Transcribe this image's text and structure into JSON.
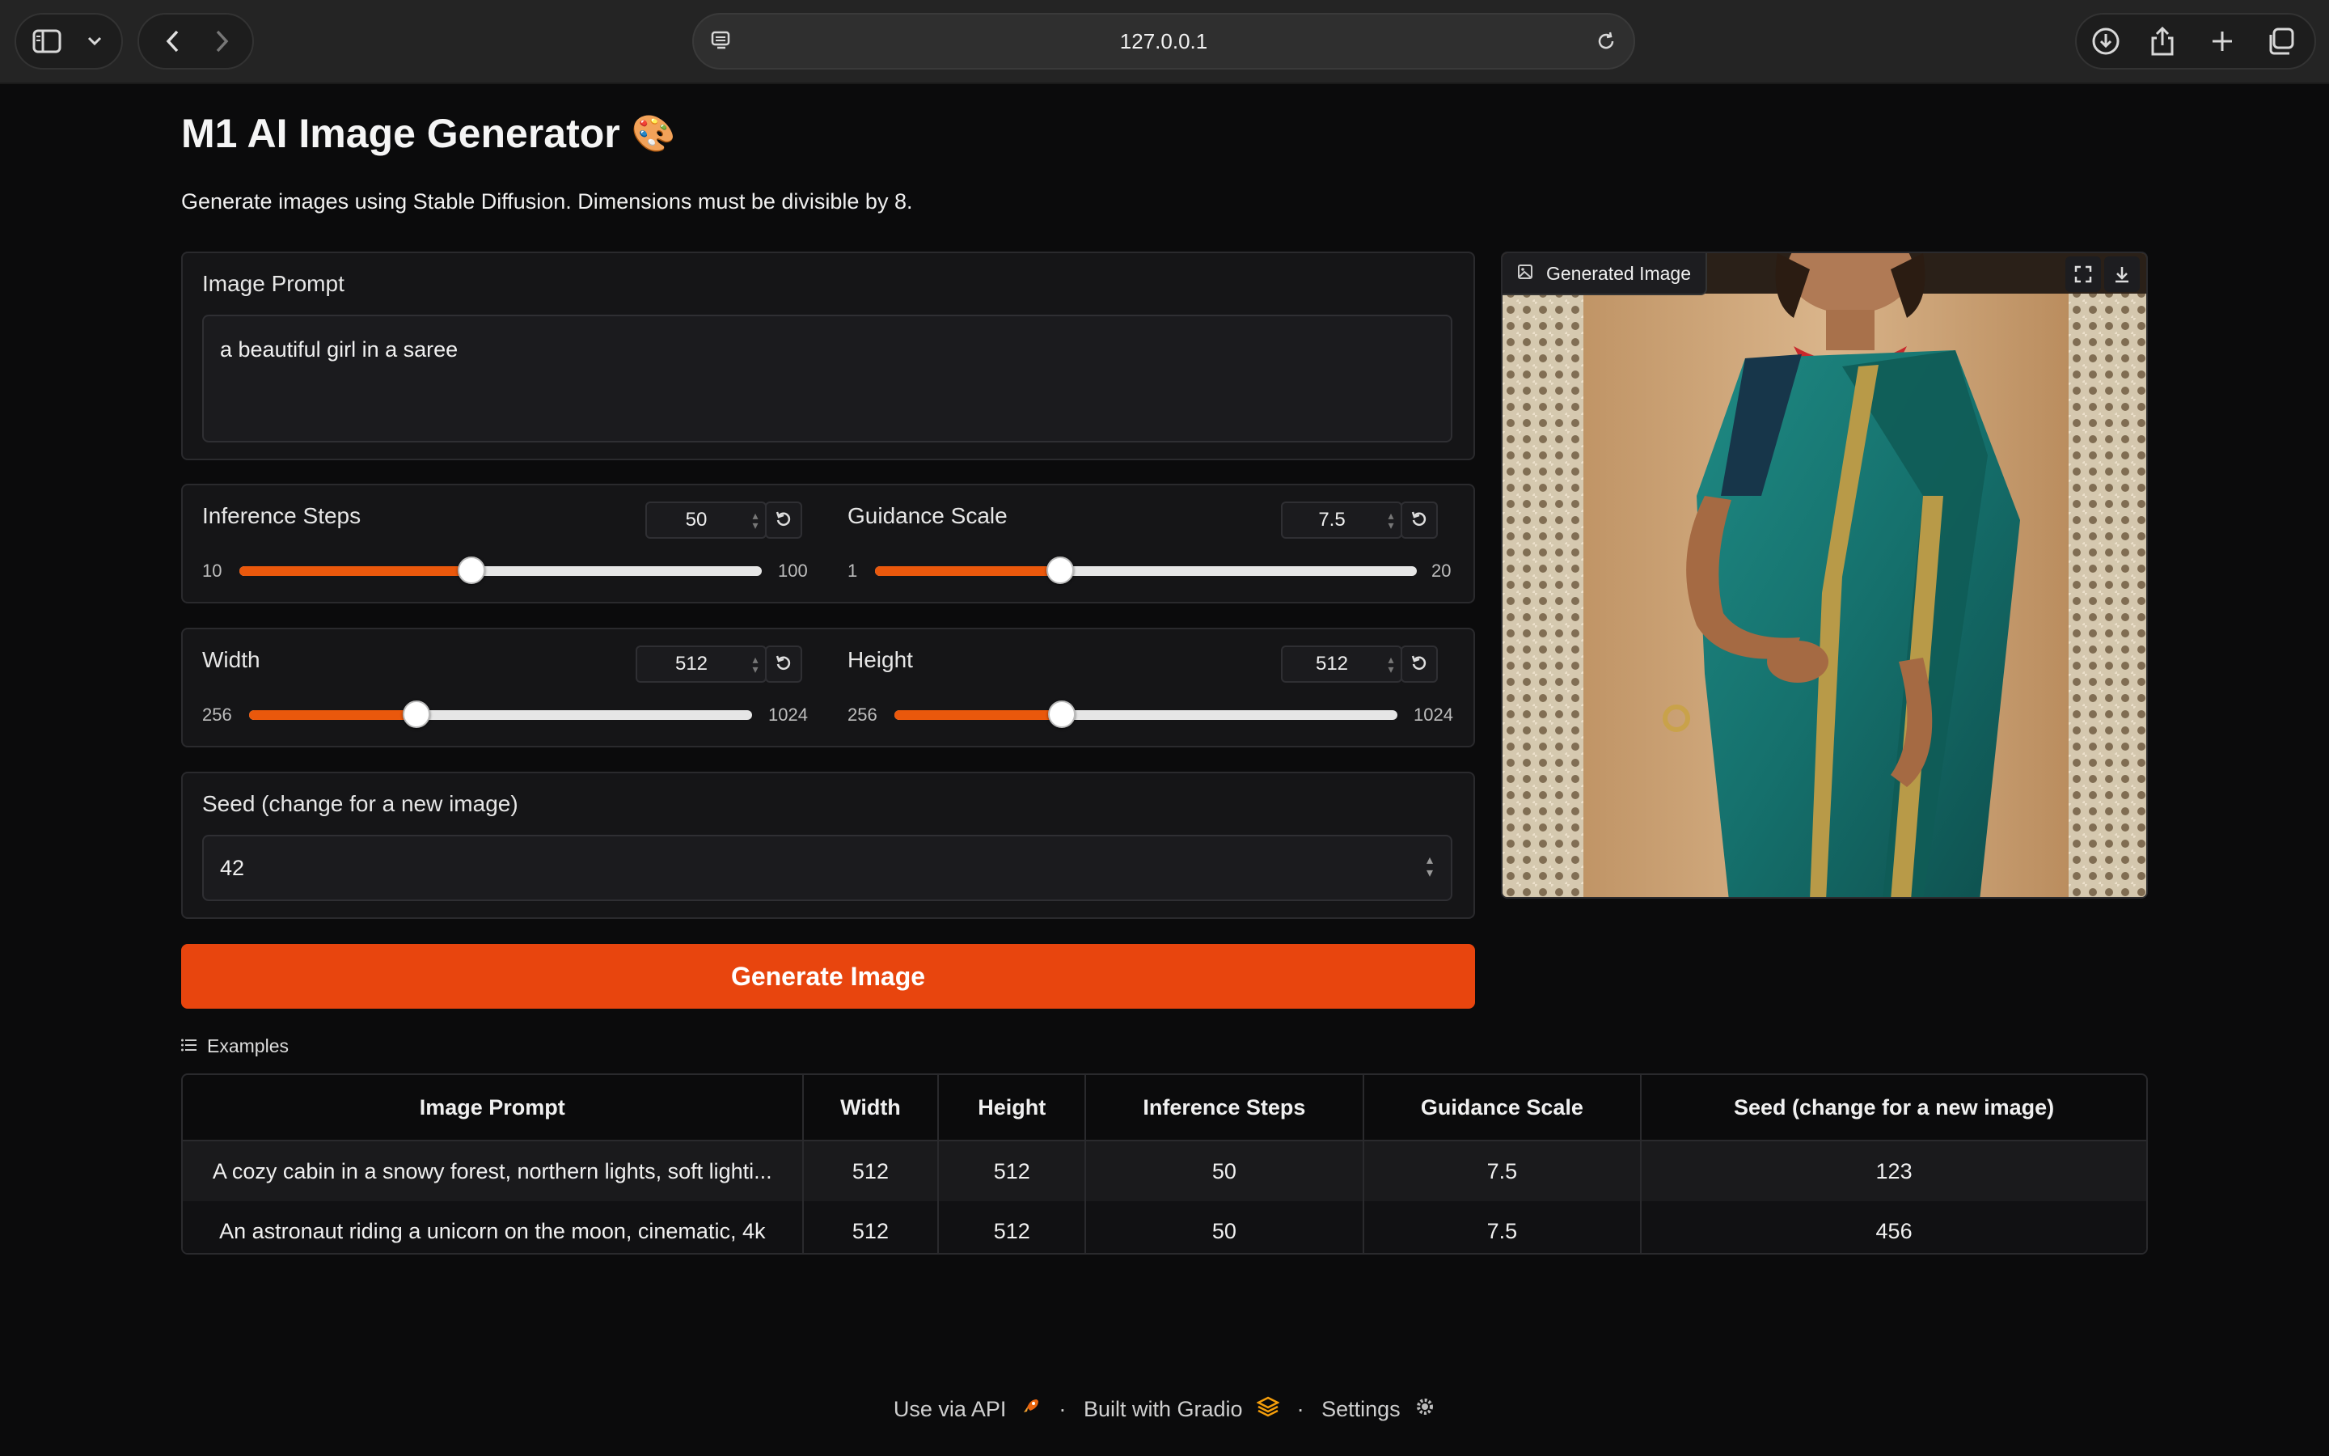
{
  "browser": {
    "url": "127.0.0.1",
    "icons": [
      "sidebar-icon",
      "chevron-down-icon",
      "back-icon",
      "forward-icon",
      "site-icon",
      "reload-icon",
      "download-icon",
      "share-icon",
      "new-tab-icon",
      "tab-overview-icon"
    ]
  },
  "app": {
    "title": "M1 AI Image Generator",
    "title_emoji": "🎨",
    "description": "Generate images using Stable Diffusion. Dimensions must be divisible by 8."
  },
  "prompt": {
    "label": "Image Prompt",
    "value": "a beautiful girl in a saree"
  },
  "sliders": {
    "steps": {
      "label": "Inference Steps",
      "value": "50",
      "min": "10",
      "max": "100",
      "fraction": 0.444
    },
    "guidance": {
      "label": "Guidance Scale",
      "value": "7.5",
      "min": "1",
      "max": "20",
      "fraction": 0.342
    },
    "width": {
      "label": "Width",
      "value": "512",
      "min": "256",
      "max": "1024",
      "fraction": 0.333
    },
    "height": {
      "label": "Height",
      "value": "512",
      "min": "256",
      "max": "1024",
      "fraction": 0.333
    }
  },
  "seed": {
    "label": "Seed (change for a new image)",
    "value": "42"
  },
  "generate_button": "Generate Image",
  "output": {
    "label": "Generated Image"
  },
  "examples": {
    "label": "Examples",
    "headers": [
      "Image Prompt",
      "Width",
      "Height",
      "Inference Steps",
      "Guidance Scale",
      "Seed (change for a new image)"
    ],
    "rows": [
      [
        "A cozy cabin in a snowy forest, northern lights, soft lighti...",
        "512",
        "512",
        "50",
        "7.5",
        "123"
      ],
      [
        "An astronaut riding a unicorn on the moon, cinematic, 4k",
        "512",
        "512",
        "50",
        "7.5",
        "456"
      ]
    ]
  },
  "footer": {
    "api": "Use via API",
    "built": "Built with Gradio",
    "settings": "Settings",
    "sep": "·"
  },
  "colors": {
    "accent": "#e8450e",
    "background": "#0b0b0c",
    "panel": "#151517"
  }
}
